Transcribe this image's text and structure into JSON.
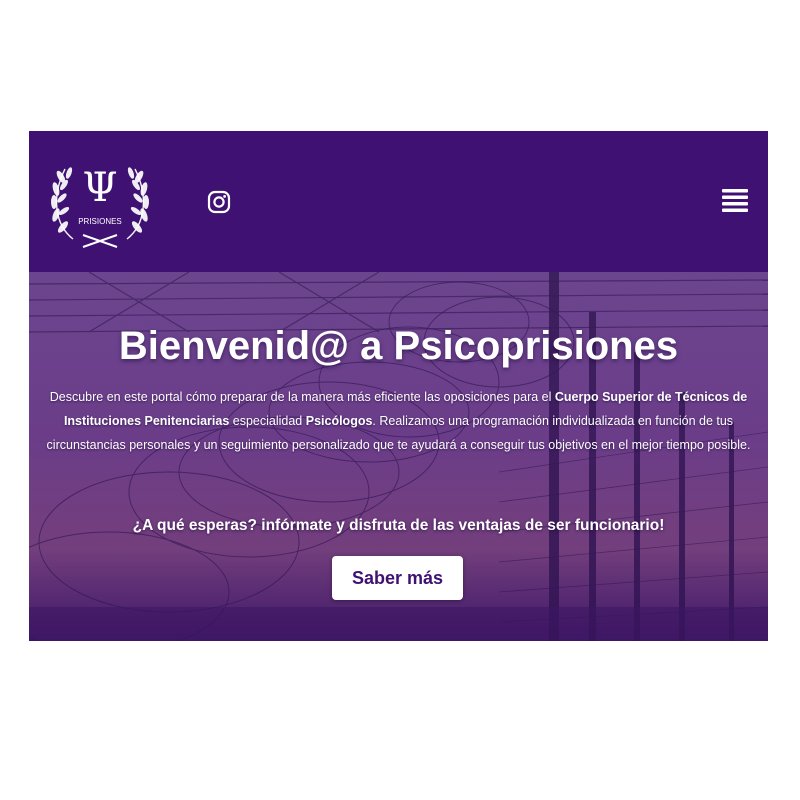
{
  "colors": {
    "brand_purple": "#3f1173",
    "hero_overlay": "#5b2a86",
    "text_white": "#ffffff"
  },
  "header": {
    "logo_text": "PRISIONES",
    "logo_symbol": "Ψ",
    "social_icon": "instagram-icon",
    "menu_icon": "hamburger-menu-icon"
  },
  "hero": {
    "title": "Bienvenid@ a Psicoprisiones",
    "description": {
      "part1": "Descubre en este portal cómo preparar de la manera más eficiente las oposiciones para el ",
      "bold1": "Cuerpo Superior de Técnicos de Instituciones Penitenciarias",
      "part2": " especialidad ",
      "bold2": "Psicólogos",
      "part3": ". Realizamos una programación individualizada en función de tus circunstancias personales y un seguimiento personalizado que te ayudará a conseguir tus objetivos en el mejor tiempo posible."
    },
    "cta_text": "¿A qué esperas? infórmate y disfruta de las ventajas de ser funcionario!",
    "cta_button": "Saber más"
  }
}
